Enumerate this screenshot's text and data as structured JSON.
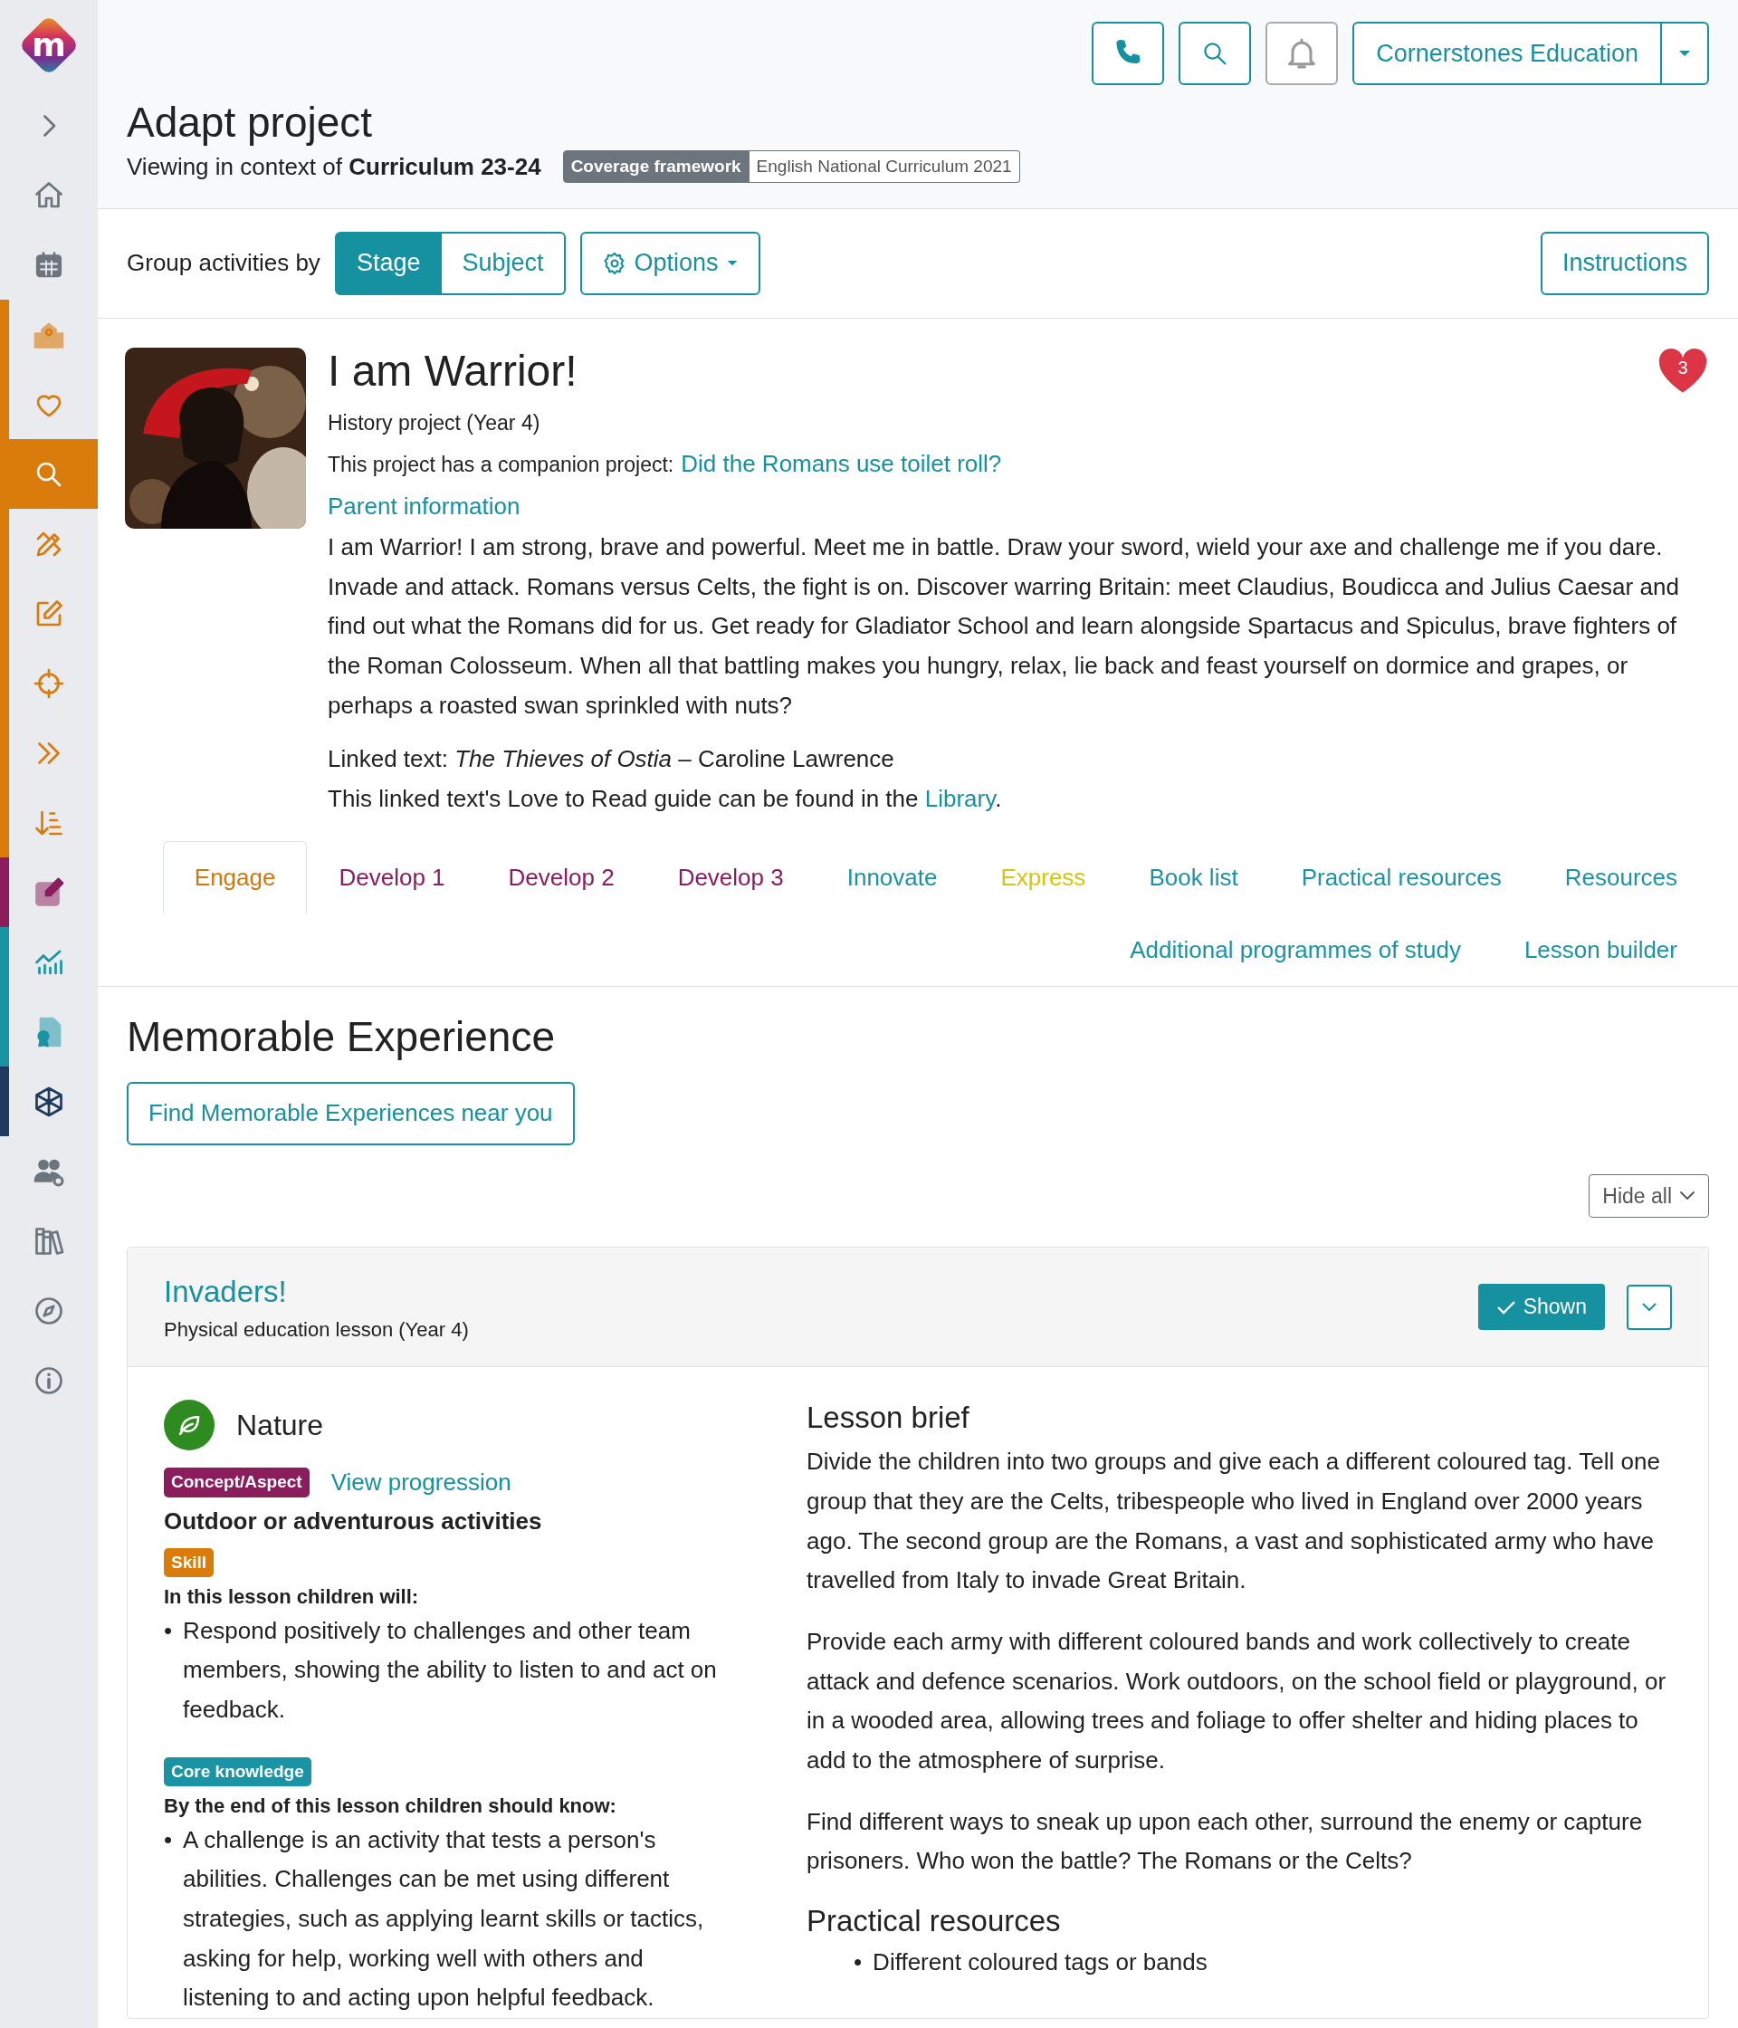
{
  "logo": {
    "letter": "m"
  },
  "sidebar": {
    "items": [
      {
        "selected": false
      },
      {
        "selected": false
      },
      {
        "selected": false
      },
      {
        "selected": false,
        "color": "#d97c0c"
      },
      {
        "selected": false,
        "color": "#d97c0c"
      },
      {
        "selected": true,
        "color": "#d97c0c"
      },
      {
        "selected": false,
        "color": "#d97c0c"
      },
      {
        "selected": false,
        "color": "#d97c0c"
      },
      {
        "selected": false,
        "color": "#d97c0c"
      },
      {
        "selected": false,
        "color": "#d97c0c"
      },
      {
        "selected": false,
        "color": "#d97c0c"
      },
      {
        "selected": false,
        "color": "#8c1d5c"
      },
      {
        "selected": false,
        "color": "#1a94a4"
      },
      {
        "selected": false,
        "color": "#1a94a4"
      },
      {
        "selected": false,
        "color": "#1f3a5f"
      },
      {
        "selected": false
      },
      {
        "selected": false
      },
      {
        "selected": false
      },
      {
        "selected": false
      }
    ]
  },
  "header": {
    "notifications_disabled": true,
    "account": "Cornerstones Education"
  },
  "page": {
    "title": "Adapt project",
    "context": "Viewing in context of **Curriculum 23-24**",
    "framework_label": "Coverage framework",
    "framework_value": "English National Curriculum 2021"
  },
  "toolbar": {
    "group_label": "Group activities by",
    "group_options": [
      {
        "label": "Stage",
        "selected": true
      },
      {
        "label": "Subject",
        "selected": false
      }
    ],
    "options_button": "Options",
    "instructions_button": "Instructions"
  },
  "project": {
    "title": "I am Warrior!",
    "subtitle": "History project (Year 4)",
    "companion_prefix": "This project has a companion project:",
    "companion_link": "Did the Romans use toilet roll?",
    "parent_link": "Parent information",
    "favourites": "3",
    "description": "I am Warrior! I am strong, brave and powerful. Meet me in battle. Draw your sword, wield your axe and challenge me if you dare. Invade and attack. Romans versus Celts, the fight is on. Discover warring Britain: meet Claudius, Boudicca and Julius Caesar and find out what the Romans did for us. Get ready for Gladiator School and learn alongside Spartacus and Spiculus, brave fighters of the Roman Colosseum. When all that battling makes you hungry, relax, lie back and feast yourself on dormice and grapes, or perhaps a roasted swan sprinkled with nuts?",
    "linked_text": "Linked text: *The Thieves of Ostia* – Caroline Lawrence",
    "guide_prefix": "This linked text's Love to Read guide can be found in the",
    "guide_link": "Library",
    "guide_suffix": "."
  },
  "tabs": [
    {
      "label": "Engage",
      "selected": true,
      "color": "#d0780f"
    },
    {
      "label": "Develop 1",
      "selected": false,
      "color": "#8c1d5c"
    },
    {
      "label": "Develop 2",
      "selected": false,
      "color": "#8c1d5c"
    },
    {
      "label": "Develop 3",
      "selected": false,
      "color": "#8c1d5c"
    },
    {
      "label": "Innovate",
      "selected": false,
      "color": "#1a94a4"
    },
    {
      "label": "Express",
      "selected": false,
      "color": "#d6c50f"
    },
    {
      "label": "Book list",
      "selected": false,
      "color": "#1a94a4"
    },
    {
      "label": "Practical resources",
      "selected": false,
      "color": "#1a94a4"
    },
    {
      "label": "Resources",
      "selected": false,
      "color": "#1a94a4"
    },
    {
      "label": "Additional programmes of study",
      "selected": false,
      "color": "#1a94a4"
    },
    {
      "label": "Lesson builder",
      "selected": false,
      "color": "#1a94a4"
    }
  ],
  "section": {
    "title": "Memorable Experience",
    "find_button": "Find Memorable Experiences near you",
    "hide_all": "Hide all"
  },
  "lesson": {
    "title": "Invaders!",
    "subtitle": "Physical education lesson (Year 4)",
    "shown_button": "Shown",
    "shown": true,
    "subject": "Nature",
    "concept_badge": "Concept/Aspect",
    "view_progression": "View progression",
    "concept": "Outdoor or adventurous activities",
    "skill_badge": "Skill",
    "skill_intro": "In this lesson children will:",
    "skill_points": [
      {
        "marker": "•",
        "text": "Respond positively to challenges and other team members, showing the ability to listen to and act on feedback."
      }
    ],
    "knowledge_badge": "Core knowledge",
    "knowledge_intro": "By the end of this lesson children should know:",
    "knowledge_points": [
      {
        "marker": "•",
        "text": "A challenge is an activity that tests a person's abilities. Challenges can be met using different strategies, such as applying learnt skills or tactics, asking for help, working well with others and listening to and acting upon helpful feedback."
      }
    ],
    "brief_title": "Lesson brief",
    "brief": [
      "Divide the children into two groups and give each a different coloured tag. Tell one group that they are the Celts, tribespeople who lived in England over 2000 years ago. The second group are the Romans, a vast and sophisticated army who have travelled from Italy to invade Great Britain.",
      "Provide each army with different coloured bands and work collectively to create attack and defence scenarios. Work outdoors, on the school field or playground, or in a wooded area, allowing trees and foliage to offer shelter and hiding places to add to the atmosphere of surprise.",
      "Find different ways to sneak up upon each other, surround the enemy or capture prisoners. Who won the battle? The Romans or the Celts?"
    ],
    "practical_title": "Practical resources",
    "practical_items": [
      {
        "marker": "•",
        "text": "Different coloured tags or bands"
      }
    ]
  }
}
